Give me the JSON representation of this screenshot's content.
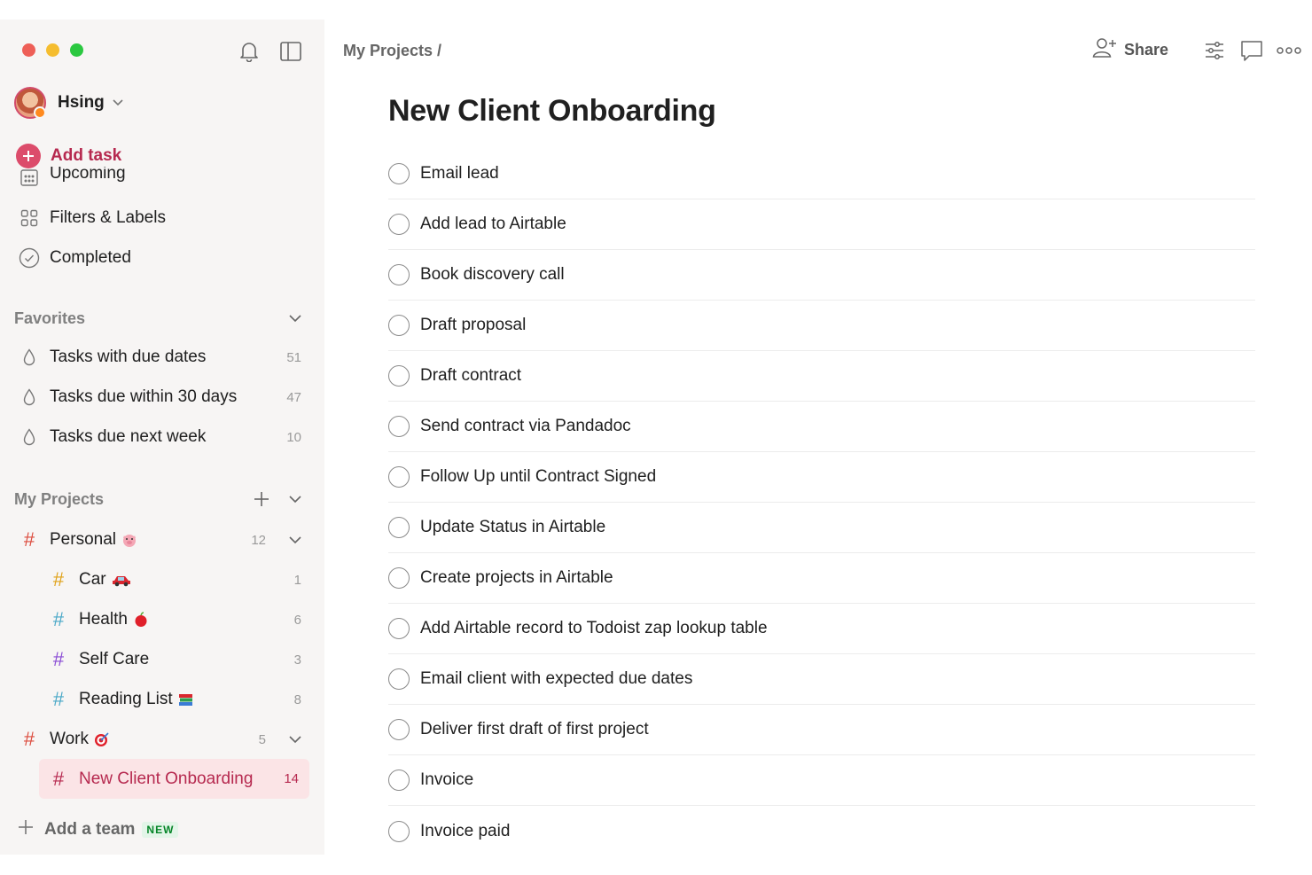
{
  "window": {
    "traffic_lights": [
      "close",
      "minimize",
      "zoom"
    ]
  },
  "sidebar": {
    "icons": {
      "notifications": "bell-icon",
      "toggle_sidebar": "sidebar-toggle-icon"
    },
    "user": {
      "name": "Hsing"
    },
    "add_task": {
      "label": "Add task"
    },
    "nav": [
      {
        "label": "Upcoming",
        "icon": "calendar-icon"
      },
      {
        "label": "Filters & Labels",
        "icon": "grid-icon"
      },
      {
        "label": "Completed",
        "icon": "check-circle-icon"
      }
    ],
    "favorites": {
      "title": "Favorites",
      "items": [
        {
          "label": "Tasks with due dates",
          "count": "51"
        },
        {
          "label": "Tasks due within 30 days",
          "count": "47"
        },
        {
          "label": "Tasks due next week",
          "count": "10"
        }
      ]
    },
    "projects": {
      "title": "My Projects",
      "items": [
        {
          "label": "Personal",
          "emoji": "pig",
          "count": "12",
          "color": "#dc4c3e"
        },
        {
          "label": "Car",
          "emoji": "car",
          "count": "1",
          "color": "#e0a21a"
        },
        {
          "label": "Health",
          "emoji": "apple",
          "count": "6",
          "color": "#4aa8c7"
        },
        {
          "label": "Self Care",
          "emoji": "",
          "count": "3",
          "color": "#8a4bd4"
        },
        {
          "label": "Reading List",
          "emoji": "books",
          "count": "8",
          "color": "#4aa8c7"
        },
        {
          "label": "Work",
          "emoji": "target",
          "count": "5",
          "color": "#dc4c3e"
        },
        {
          "label": "New Client Onboarding",
          "emoji": "",
          "count": "14",
          "color": "#b6294f"
        }
      ]
    },
    "add_team": {
      "label": "Add a team",
      "badge": "NEW"
    }
  },
  "main": {
    "breadcrumb": "My Projects /",
    "share_label": "Share",
    "title": "New Client Onboarding",
    "tasks": [
      "Email lead",
      "Add lead to Airtable",
      "Book discovery call",
      "Draft proposal",
      "Draft contract",
      "Send contract via Pandadoc",
      "Follow Up until Contract Signed",
      "Update Status in Airtable",
      "Create projects in Airtable",
      "Add Airtable record to Todoist zap lookup table",
      "Email client with expected due dates",
      "Deliver first draft of first project",
      "Invoice",
      "Invoice paid"
    ]
  },
  "colors": {
    "accent": "#dc4c6b",
    "accent_text": "#b6294f",
    "sidebar_bg": "#f7f5f4",
    "active_bg": "#fbe4e6"
  }
}
